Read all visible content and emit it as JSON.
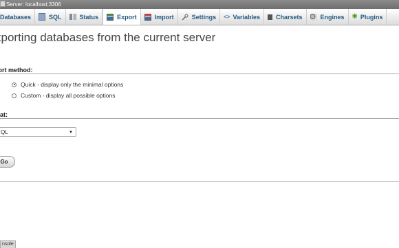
{
  "window": {
    "server_title": "Server: localhost:3306"
  },
  "tabs": [
    {
      "label": "Databases",
      "icon": "database-icon"
    },
    {
      "label": "SQL",
      "icon": "sql-icon"
    },
    {
      "label": "Status",
      "icon": "status-icon"
    },
    {
      "label": "Export",
      "icon": "export-icon",
      "active": true
    },
    {
      "label": "Import",
      "icon": "import-icon"
    },
    {
      "label": "Settings",
      "icon": "settings-icon"
    },
    {
      "label": "Variables",
      "icon": "variables-icon"
    },
    {
      "label": "Charsets",
      "icon": "charsets-icon"
    },
    {
      "label": "Engines",
      "icon": "engines-icon"
    },
    {
      "label": "Plugins",
      "icon": "plugins-icon"
    }
  ],
  "page": {
    "title": "xporting databases from the current server"
  },
  "export_method": {
    "label": "port method:",
    "options": [
      {
        "label": "Quick - display only the minimal options",
        "checked": true
      },
      {
        "label": "Custom - display all possible options",
        "checked": false
      }
    ]
  },
  "format": {
    "label": "mat:",
    "selected": "QL"
  },
  "go_button": {
    "label": "Go"
  },
  "console": {
    "label": "nsole"
  }
}
